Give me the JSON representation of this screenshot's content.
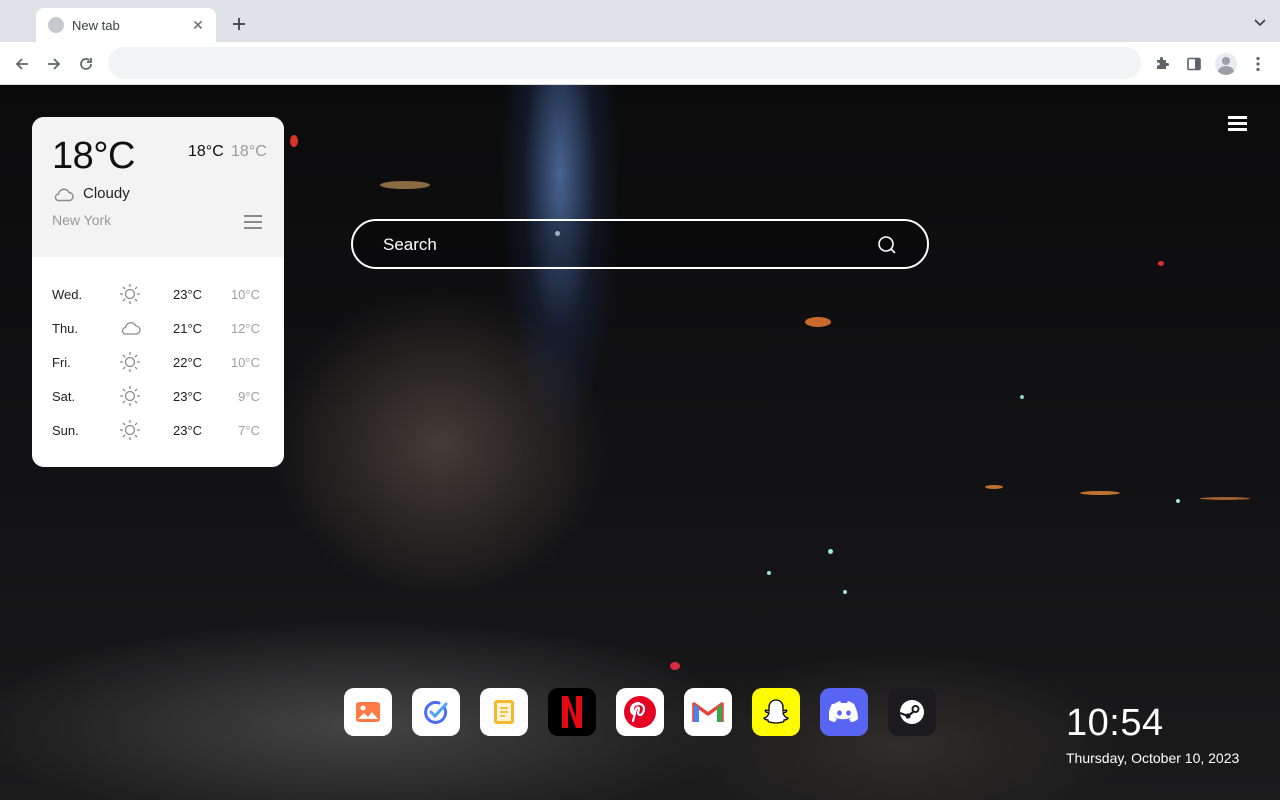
{
  "browser": {
    "tab_title": "New tab",
    "tab_close_glyph": "✕",
    "new_tab_glyph": "+",
    "omnibox_value": ""
  },
  "weather": {
    "current_temp": "18°C",
    "high": "18°C",
    "low": "18°C",
    "condition": "Cloudy",
    "condition_icon": "cloud-icon",
    "city": "New York",
    "forecast": [
      {
        "day": "Wed.",
        "icon": "sun-icon",
        "high": "23°C",
        "low": "10°C"
      },
      {
        "day": "Thu.",
        "icon": "cloud-icon",
        "high": "21°C",
        "low": "12°C"
      },
      {
        "day": "Fri.",
        "icon": "sun-icon",
        "high": "22°C",
        "low": "10°C"
      },
      {
        "day": "Sat.",
        "icon": "sun-icon",
        "high": "23°C",
        "low": "9°C"
      },
      {
        "day": "Sun.",
        "icon": "sun-icon",
        "high": "23°C",
        "low": "7°C"
      }
    ]
  },
  "search": {
    "placeholder": "Search"
  },
  "dock": {
    "apps": [
      {
        "name": "photos",
        "icon": "image-icon",
        "bg": "#ffffff"
      },
      {
        "name": "checkmark-app",
        "icon": "check-icon",
        "bg": "#ffffff"
      },
      {
        "name": "notes",
        "icon": "notes-icon",
        "bg": "#ffffff"
      },
      {
        "name": "netflix",
        "icon": "netflix-icon",
        "bg": "#000000"
      },
      {
        "name": "pinterest",
        "icon": "pinterest-icon",
        "bg": "#ffffff"
      },
      {
        "name": "gmail",
        "icon": "gmail-icon",
        "bg": "#ffffff"
      },
      {
        "name": "snapchat",
        "icon": "snapchat-icon",
        "bg": "#fffc00"
      },
      {
        "name": "discord",
        "icon": "discord-icon",
        "bg": "#5865f2"
      },
      {
        "name": "steam",
        "icon": "steam-icon",
        "bg": "#1b1b1f"
      }
    ]
  },
  "clock": {
    "time": "10:54",
    "date": "Thursday, October 10, 2023"
  }
}
